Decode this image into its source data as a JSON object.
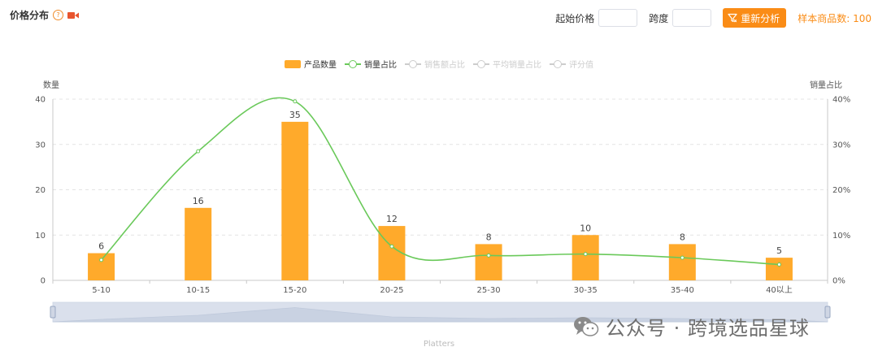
{
  "header": {
    "title": "价格分布",
    "help_icon": "question-circle-icon",
    "video_icon": "video-camera-icon"
  },
  "controls": {
    "start_price_label": "起始价格",
    "start_price_value": "",
    "span_label": "跨度",
    "span_value": "",
    "reanalyze_label": "重新分析",
    "reanalyze_icon": "filter-icon",
    "sample_count": "样本商品数: 100",
    "accent_color": "#fa8c16"
  },
  "legend": [
    {
      "label": "产品数量",
      "active": true,
      "kind": "bar"
    },
    {
      "label": "销量占比",
      "active": true,
      "kind": "line"
    },
    {
      "label": "销售额占比",
      "active": false,
      "kind": "line"
    },
    {
      "label": "平均销量占比",
      "active": false,
      "kind": "line"
    },
    {
      "label": "评分值",
      "active": false,
      "kind": "line"
    }
  ],
  "chart_data": {
    "type": "bar",
    "categories": [
      "5-10",
      "10-15",
      "15-20",
      "20-25",
      "25-30",
      "30-35",
      "35-40",
      "40以上"
    ],
    "series": [
      {
        "name": "产品数量",
        "type": "bar",
        "axis": "left",
        "values": [
          6,
          16,
          35,
          12,
          8,
          10,
          8,
          5
        ],
        "color": "#ffaa2b"
      },
      {
        "name": "销量占比",
        "type": "line",
        "axis": "right",
        "smooth": true,
        "values": [
          4.5,
          28.5,
          39.5,
          7.5,
          5.5,
          5.8,
          5.0,
          3.5
        ],
        "color": "#6ac95a"
      }
    ],
    "y_left": {
      "label": "数量",
      "ticks": [
        "0",
        "10",
        "20",
        "30",
        "40"
      ],
      "range": [
        0,
        40
      ]
    },
    "y_right": {
      "label": "销量占比",
      "ticks": [
        "0%",
        "10%",
        "20%",
        "30%",
        "40%"
      ],
      "range": [
        0,
        40
      ]
    },
    "grid": true,
    "legend_position": "top-center",
    "datazoom_label": "Platters"
  },
  "watermark": {
    "text": "公众号 · 跨境选品星球",
    "icon": "wechat-icon"
  }
}
